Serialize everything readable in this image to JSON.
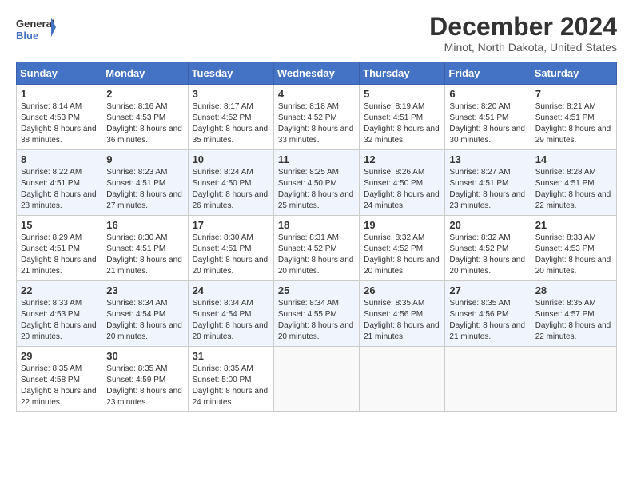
{
  "header": {
    "logo_line1": "General",
    "logo_line2": "Blue",
    "month_title": "December 2024",
    "location": "Minot, North Dakota, United States"
  },
  "days_of_week": [
    "Sunday",
    "Monday",
    "Tuesday",
    "Wednesday",
    "Thursday",
    "Friday",
    "Saturday"
  ],
  "weeks": [
    [
      {
        "day": "1",
        "sunrise": "Sunrise: 8:14 AM",
        "sunset": "Sunset: 4:53 PM",
        "daylight": "Daylight: 8 hours and 38 minutes."
      },
      {
        "day": "2",
        "sunrise": "Sunrise: 8:16 AM",
        "sunset": "Sunset: 4:53 PM",
        "daylight": "Daylight: 8 hours and 36 minutes."
      },
      {
        "day": "3",
        "sunrise": "Sunrise: 8:17 AM",
        "sunset": "Sunset: 4:52 PM",
        "daylight": "Daylight: 8 hours and 35 minutes."
      },
      {
        "day": "4",
        "sunrise": "Sunrise: 8:18 AM",
        "sunset": "Sunset: 4:52 PM",
        "daylight": "Daylight: 8 hours and 33 minutes."
      },
      {
        "day": "5",
        "sunrise": "Sunrise: 8:19 AM",
        "sunset": "Sunset: 4:51 PM",
        "daylight": "Daylight: 8 hours and 32 minutes."
      },
      {
        "day": "6",
        "sunrise": "Sunrise: 8:20 AM",
        "sunset": "Sunset: 4:51 PM",
        "daylight": "Daylight: 8 hours and 30 minutes."
      },
      {
        "day": "7",
        "sunrise": "Sunrise: 8:21 AM",
        "sunset": "Sunset: 4:51 PM",
        "daylight": "Daylight: 8 hours and 29 minutes."
      }
    ],
    [
      {
        "day": "8",
        "sunrise": "Sunrise: 8:22 AM",
        "sunset": "Sunset: 4:51 PM",
        "daylight": "Daylight: 8 hours and 28 minutes."
      },
      {
        "day": "9",
        "sunrise": "Sunrise: 8:23 AM",
        "sunset": "Sunset: 4:51 PM",
        "daylight": "Daylight: 8 hours and 27 minutes."
      },
      {
        "day": "10",
        "sunrise": "Sunrise: 8:24 AM",
        "sunset": "Sunset: 4:50 PM",
        "daylight": "Daylight: 8 hours and 26 minutes."
      },
      {
        "day": "11",
        "sunrise": "Sunrise: 8:25 AM",
        "sunset": "Sunset: 4:50 PM",
        "daylight": "Daylight: 8 hours and 25 minutes."
      },
      {
        "day": "12",
        "sunrise": "Sunrise: 8:26 AM",
        "sunset": "Sunset: 4:50 PM",
        "daylight": "Daylight: 8 hours and 24 minutes."
      },
      {
        "day": "13",
        "sunrise": "Sunrise: 8:27 AM",
        "sunset": "Sunset: 4:51 PM",
        "daylight": "Daylight: 8 hours and 23 minutes."
      },
      {
        "day": "14",
        "sunrise": "Sunrise: 8:28 AM",
        "sunset": "Sunset: 4:51 PM",
        "daylight": "Daylight: 8 hours and 22 minutes."
      }
    ],
    [
      {
        "day": "15",
        "sunrise": "Sunrise: 8:29 AM",
        "sunset": "Sunset: 4:51 PM",
        "daylight": "Daylight: 8 hours and 21 minutes."
      },
      {
        "day": "16",
        "sunrise": "Sunrise: 8:30 AM",
        "sunset": "Sunset: 4:51 PM",
        "daylight": "Daylight: 8 hours and 21 minutes."
      },
      {
        "day": "17",
        "sunrise": "Sunrise: 8:30 AM",
        "sunset": "Sunset: 4:51 PM",
        "daylight": "Daylight: 8 hours and 20 minutes."
      },
      {
        "day": "18",
        "sunrise": "Sunrise: 8:31 AM",
        "sunset": "Sunset: 4:52 PM",
        "daylight": "Daylight: 8 hours and 20 minutes."
      },
      {
        "day": "19",
        "sunrise": "Sunrise: 8:32 AM",
        "sunset": "Sunset: 4:52 PM",
        "daylight": "Daylight: 8 hours and 20 minutes."
      },
      {
        "day": "20",
        "sunrise": "Sunrise: 8:32 AM",
        "sunset": "Sunset: 4:52 PM",
        "daylight": "Daylight: 8 hours and 20 minutes."
      },
      {
        "day": "21",
        "sunrise": "Sunrise: 8:33 AM",
        "sunset": "Sunset: 4:53 PM",
        "daylight": "Daylight: 8 hours and 20 minutes."
      }
    ],
    [
      {
        "day": "22",
        "sunrise": "Sunrise: 8:33 AM",
        "sunset": "Sunset: 4:53 PM",
        "daylight": "Daylight: 8 hours and 20 minutes."
      },
      {
        "day": "23",
        "sunrise": "Sunrise: 8:34 AM",
        "sunset": "Sunset: 4:54 PM",
        "daylight": "Daylight: 8 hours and 20 minutes."
      },
      {
        "day": "24",
        "sunrise": "Sunrise: 8:34 AM",
        "sunset": "Sunset: 4:54 PM",
        "daylight": "Daylight: 8 hours and 20 minutes."
      },
      {
        "day": "25",
        "sunrise": "Sunrise: 8:34 AM",
        "sunset": "Sunset: 4:55 PM",
        "daylight": "Daylight: 8 hours and 20 minutes."
      },
      {
        "day": "26",
        "sunrise": "Sunrise: 8:35 AM",
        "sunset": "Sunset: 4:56 PM",
        "daylight": "Daylight: 8 hours and 21 minutes."
      },
      {
        "day": "27",
        "sunrise": "Sunrise: 8:35 AM",
        "sunset": "Sunset: 4:56 PM",
        "daylight": "Daylight: 8 hours and 21 minutes."
      },
      {
        "day": "28",
        "sunrise": "Sunrise: 8:35 AM",
        "sunset": "Sunset: 4:57 PM",
        "daylight": "Daylight: 8 hours and 22 minutes."
      }
    ],
    [
      {
        "day": "29",
        "sunrise": "Sunrise: 8:35 AM",
        "sunset": "Sunset: 4:58 PM",
        "daylight": "Daylight: 8 hours and 22 minutes."
      },
      {
        "day": "30",
        "sunrise": "Sunrise: 8:35 AM",
        "sunset": "Sunset: 4:59 PM",
        "daylight": "Daylight: 8 hours and 23 minutes."
      },
      {
        "day": "31",
        "sunrise": "Sunrise: 8:35 AM",
        "sunset": "Sunset: 5:00 PM",
        "daylight": "Daylight: 8 hours and 24 minutes."
      },
      null,
      null,
      null,
      null
    ]
  ]
}
